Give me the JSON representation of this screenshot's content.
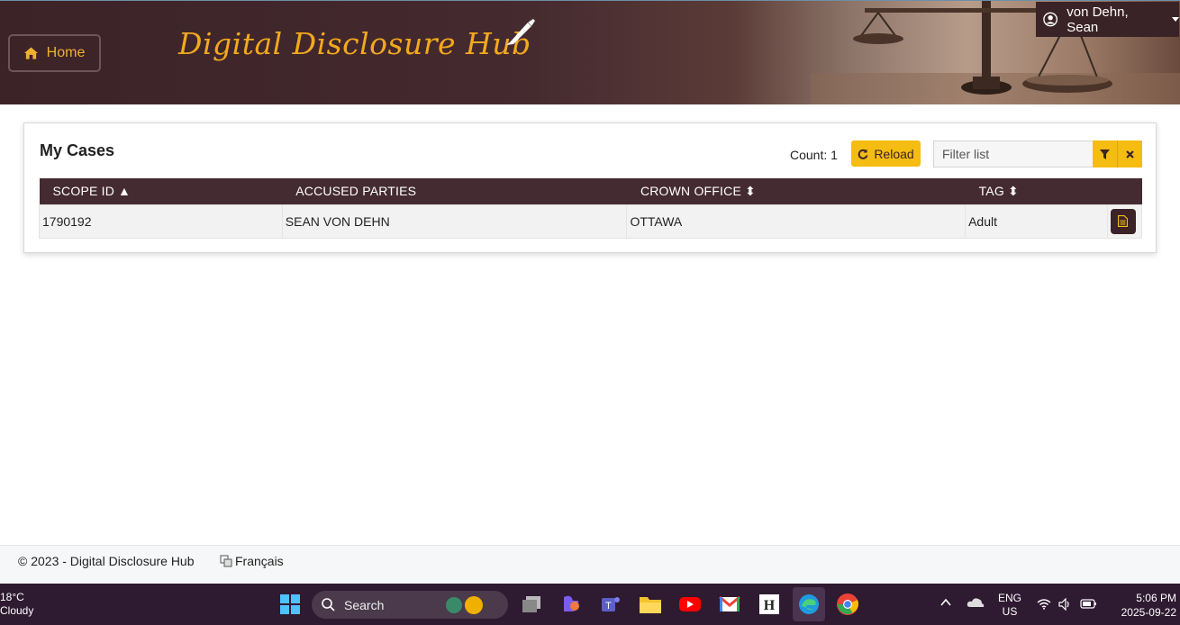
{
  "header": {
    "home_label": "Home",
    "brand": "Digital Disclosure Hub",
    "user_name": "von Dehn, Sean"
  },
  "cases": {
    "title": "My Cases",
    "count_label": "Count: 1",
    "reload_label": "Reload",
    "filter_placeholder": "Filter list",
    "columns": {
      "scope_id": "SCOPE ID",
      "accused": "ACCUSED PARTIES",
      "office": "CROWN OFFICE",
      "tag": "TAG"
    },
    "rows": [
      {
        "scope_id": "1790192",
        "accused": "SEAN VON DEHN",
        "office": "OTTAWA",
        "tag": "Adult"
      }
    ]
  },
  "footer": {
    "copyright": "© 2023 - Digital Disclosure Hub",
    "language": "Français"
  },
  "taskbar": {
    "temperature": "18°C",
    "condition": "Cloudy",
    "search_label": "Search",
    "lang_top": "ENG",
    "lang_bottom": "US",
    "time": "5:06 PM",
    "date": "2025-09-22"
  },
  "colors": {
    "header_bg": "#3b2328",
    "accent": "#f5bc12",
    "brand_text": "#f2a91e",
    "table_header": "#442b31"
  }
}
